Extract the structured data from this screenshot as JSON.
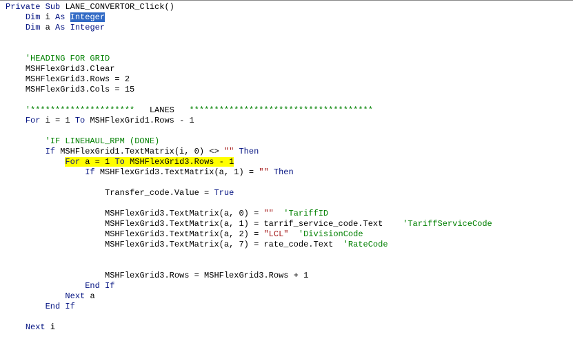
{
  "line01": {
    "k1": "Private",
    "sp1": " ",
    "k2": "Sub",
    "sp2": " ",
    "name": "LANE_CONVERTOR_Click",
    "paren": "()"
  },
  "line02": {
    "ind": "    ",
    "k1": "Dim",
    "sp1": " ",
    "v": "i",
    "sp2": " ",
    "k2": "As",
    "sp3": " ",
    "sel": "Integer"
  },
  "line03": {
    "ind": "    ",
    "k1": "Dim",
    "sp1": " ",
    "v": "a",
    "sp2": " ",
    "k2": "As",
    "sp3": " ",
    "t": "Integer"
  },
  "line05": {
    "ind": "    ",
    "c": "'HEADING FOR GRID"
  },
  "line06": {
    "ind": "    ",
    "t": "MSHFlexGrid3.Clear"
  },
  "line07": {
    "ind": "    ",
    "t1": "MSHFlexGrid3.Rows = ",
    "n": "2"
  },
  "line08": {
    "ind": "    ",
    "t1": "MSHFlexGrid3.Cols = ",
    "n": "15"
  },
  "line10": {
    "ind": "    ",
    "c1": "'*********************",
    "sp": "   ",
    "label": "LANES",
    "sp2": "   ",
    "c2": "*************************************"
  },
  "line11": {
    "ind": "    ",
    "k1": "For",
    "sp1": " ",
    "v": "i = ",
    "n1": "1",
    "sp2": " ",
    "k2": "To",
    "sp3": " ",
    "t": "MSHFlexGrid1.Rows - ",
    "n2": "1"
  },
  "line13": {
    "ind": "        ",
    "c": "'IF LINEHAUL_RPM (DONE)"
  },
  "line14": {
    "ind": "        ",
    "k1": "If",
    "sp1": " ",
    "t1": "MSHFlexGrid1.TextMatrix(i, ",
    "n": "0",
    "t2": ") <> ",
    "s": "\"\"",
    "sp2": " ",
    "k2": "Then"
  },
  "line15": {
    "ind": "            ",
    "hl_k1": "For",
    "hl_sp1": " ",
    "hl_v": "a = ",
    "hl_n1": "1",
    "hl_sp2": " ",
    "hl_k2": "To",
    "hl_sp3": " ",
    "hl_t": "MSHFlexGrid3.Rows - ",
    "hl_n2": "1"
  },
  "line16": {
    "ind": "                ",
    "k1": "If",
    "sp1": " ",
    "t1": "MSHFlexGrid3.TextMatrix(a, ",
    "n": "1",
    "t2": ") = ",
    "s": "\"\"",
    "sp2": " ",
    "k2": "Then"
  },
  "line18": {
    "ind": "                    ",
    "t": "Transfer_code.Value = ",
    "k": "True"
  },
  "line20": {
    "ind": "                    ",
    "t1": "MSHFlexGrid3.TextMatrix(a, ",
    "n": "0",
    "t2": ") = ",
    "s": "\"\"",
    "sp": "  ",
    "c": "'TariffID"
  },
  "line21": {
    "ind": "                    ",
    "t1": "MSHFlexGrid3.TextMatrix(a, ",
    "n": "1",
    "t2": ") = tarrif_service_code.Text",
    "sp": "    ",
    "c": "'TariffServiceCode"
  },
  "line22": {
    "ind": "                    ",
    "t1": "MSHFlexGrid3.TextMatrix(a, ",
    "n": "2",
    "t2": ") = ",
    "s": "\"LCL\"",
    "sp": "  ",
    "c": "'DivisionCode"
  },
  "line23": {
    "ind": "                    ",
    "t1": "MSHFlexGrid3.TextMatrix(a, ",
    "n": "7",
    "t2": ") = rate_code.Text",
    "sp": "  ",
    "c": "'RateCode"
  },
  "line26": {
    "ind": "                    ",
    "t1": "MSHFlexGrid3.Rows = MSHFlexGrid3.Rows + ",
    "n": "1"
  },
  "line27": {
    "ind": "                ",
    "k1": "End",
    "sp": " ",
    "k2": "If"
  },
  "line28": {
    "ind": "            ",
    "k": "Next",
    "sp": " ",
    "v": "a"
  },
  "line29": {
    "ind": "        ",
    "k1": "End",
    "sp": " ",
    "k2": "If"
  },
  "line31": {
    "ind": "    ",
    "k": "Next",
    "sp": " ",
    "v": "i"
  }
}
